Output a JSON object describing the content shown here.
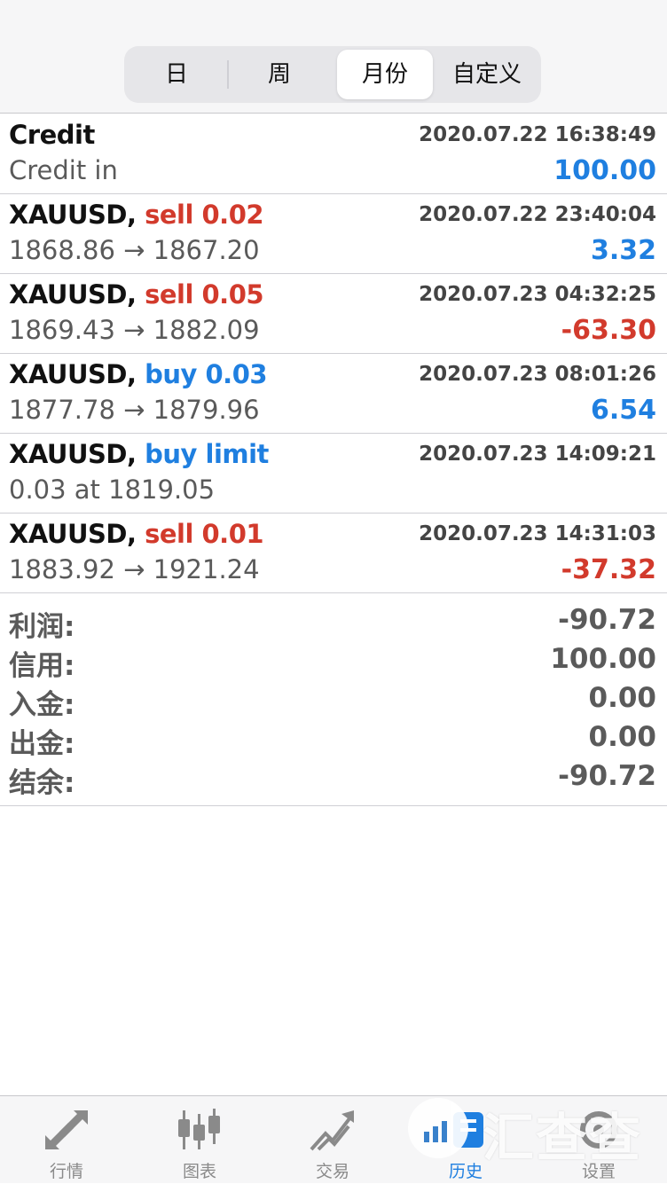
{
  "segments": [
    {
      "label": "日",
      "active": false
    },
    {
      "label": "周",
      "active": false
    },
    {
      "label": "月份",
      "active": true
    },
    {
      "label": "自定义",
      "active": false
    }
  ],
  "rows": [
    {
      "symbol": "Credit",
      "action": "",
      "time": "2020.07.22 16:38:49",
      "detail": "Credit in",
      "value": "100.00"
    },
    {
      "symbol": "XAUUSD,",
      "action": "sell 0.02",
      "time": "2020.07.22 23:40:04",
      "detail": "1868.86 → 1867.20",
      "value": "3.32"
    },
    {
      "symbol": "XAUUSD,",
      "action": "sell 0.05",
      "time": "2020.07.23 04:32:25",
      "detail": "1869.43 → 1882.09",
      "value": "-63.30"
    },
    {
      "symbol": "XAUUSD,",
      "action": "buy 0.03",
      "time": "2020.07.23 08:01:26",
      "detail": "1877.78 → 1879.96",
      "value": "6.54"
    },
    {
      "symbol": "XAUUSD,",
      "action": "buy limit",
      "time": "2020.07.23 14:09:21",
      "detail": "0.03 at 1819.05",
      "value": ""
    },
    {
      "symbol": "XAUUSD,",
      "action": "sell 0.01",
      "time": "2020.07.23 14:31:03",
      "detail": "1883.92 → 1921.24",
      "value": "-37.32"
    }
  ],
  "summary": [
    {
      "label": "利润:",
      "value": "-90.72"
    },
    {
      "label": "信用:",
      "value": "100.00"
    },
    {
      "label": "入金:",
      "value": "0.00"
    },
    {
      "label": "出金:",
      "value": "0.00"
    },
    {
      "label": "结余:",
      "value": "-90.72"
    }
  ],
  "tabs": [
    {
      "label": "行情",
      "icon": "quotes-arrows-icon",
      "active": false
    },
    {
      "label": "图表",
      "icon": "candlestick-chart-icon",
      "active": false
    },
    {
      "label": "交易",
      "icon": "trade-trend-icon",
      "active": false
    },
    {
      "label": "历史",
      "icon": "history-icon",
      "active": true
    },
    {
      "label": "设置",
      "icon": "settings-icon",
      "active": false
    }
  ],
  "watermark": {
    "text": "汇查查"
  },
  "colors": {
    "positive": "#1f7fe0",
    "negative": "#d23a2c",
    "accent": "#1f7fe0"
  }
}
